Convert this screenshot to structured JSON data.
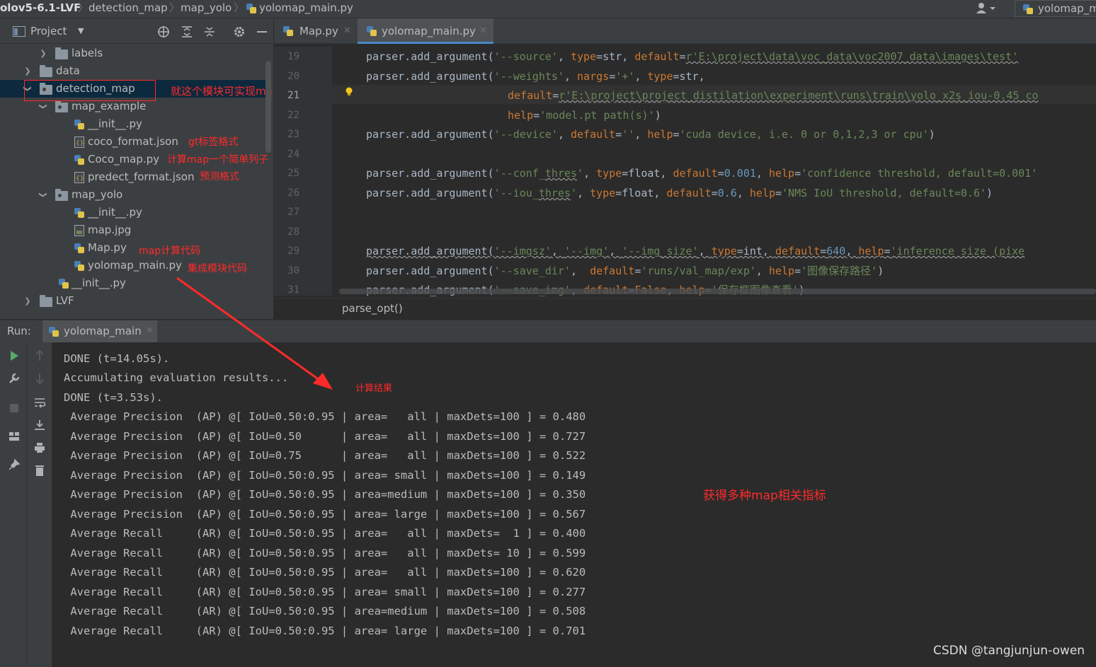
{
  "navbar": {
    "crumbs": [
      "olov5-6.1-LVF",
      "detection_map",
      "map_yolo",
      "yolomap_main.py"
    ],
    "run_config": "yolomap_m"
  },
  "project": {
    "title": "Project",
    "tree": [
      {
        "label": "labels",
        "type": "folder"
      },
      {
        "label": "data",
        "type": "folder"
      },
      {
        "label": "detection_map",
        "type": "package",
        "selected": true
      },
      {
        "label": "map_example",
        "type": "package"
      },
      {
        "label": "__init__.py",
        "type": "python"
      },
      {
        "label": "coco_format.json",
        "type": "json"
      },
      {
        "label": "Coco_map.py",
        "type": "python"
      },
      {
        "label": "predect_format.json",
        "type": "json"
      },
      {
        "label": "map_yolo",
        "type": "package"
      },
      {
        "label": "__init__.py",
        "type": "python"
      },
      {
        "label": "map.jpg",
        "type": "image"
      },
      {
        "label": "Map.py",
        "type": "python"
      },
      {
        "label": "yolomap_main.py",
        "type": "python"
      },
      {
        "label": "__init__.py",
        "type": "python"
      },
      {
        "label": "LVF",
        "type": "folder"
      }
    ],
    "annotations": {
      "detection_map": "就这个模块可实现map计算",
      "coco_format": "gt标签格式",
      "coco_map": "计算map一个简单列子",
      "predect_format": "预测格式",
      "map_py": "map计算代码",
      "yolomap_main": "集成模块代码"
    }
  },
  "editor": {
    "tabs": [
      {
        "label": "Map.py",
        "active": false
      },
      {
        "label": "yolomap_main.py",
        "active": true
      }
    ],
    "line_numbers": [
      "19",
      "20",
      "21",
      "22",
      "23",
      "24",
      "25",
      "26",
      "27",
      "28",
      "29",
      "30",
      "31"
    ],
    "current_line": "21",
    "breadcrumb": "parse_opt()"
  },
  "run": {
    "label": "Run:",
    "tab": "yolomap_main",
    "console_lines": [
      "DONE (t=14.05s).",
      "Accumulating evaluation results...",
      "DONE (t=3.53s)."
    ],
    "metrics": [
      " Average Precision  (AP) @[ IoU=0.50:0.95 | area=   all | maxDets=100 ] = 0.480",
      " Average Precision  (AP) @[ IoU=0.50      | area=   all | maxDets=100 ] = 0.727",
      " Average Precision  (AP) @[ IoU=0.75      | area=   all | maxDets=100 ] = 0.522",
      " Average Precision  (AP) @[ IoU=0.50:0.95 | area= small | maxDets=100 ] = 0.149",
      " Average Precision  (AP) @[ IoU=0.50:0.95 | area=medium | maxDets=100 ] = 0.350",
      " Average Precision  (AP) @[ IoU=0.50:0.95 | area= large | maxDets=100 ] = 0.567",
      " Average Recall     (AR) @[ IoU=0.50:0.95 | area=   all | maxDets=  1 ] = 0.400",
      " Average Recall     (AR) @[ IoU=0.50:0.95 | area=   all | maxDets= 10 ] = 0.599",
      " Average Recall     (AR) @[ IoU=0.50:0.95 | area=   all | maxDets=100 ] = 0.620",
      " Average Recall     (AR) @[ IoU=0.50:0.95 | area= small | maxDets=100 ] = 0.277",
      " Average Recall     (AR) @[ IoU=0.50:0.95 | area=medium | maxDets=100 ] = 0.508",
      " Average Recall     (AR) @[ IoU=0.50:0.95 | area= large | maxDets=100 ] = 0.701"
    ],
    "annotations": {
      "result": "计算结果",
      "metrics": "获得多种map相关指标"
    }
  },
  "watermark": "CSDN @tangjunjun-owen",
  "colors": {
    "annotation": "#ff2a2a",
    "selection": "#0d293e",
    "accent": "#4a88c7"
  }
}
